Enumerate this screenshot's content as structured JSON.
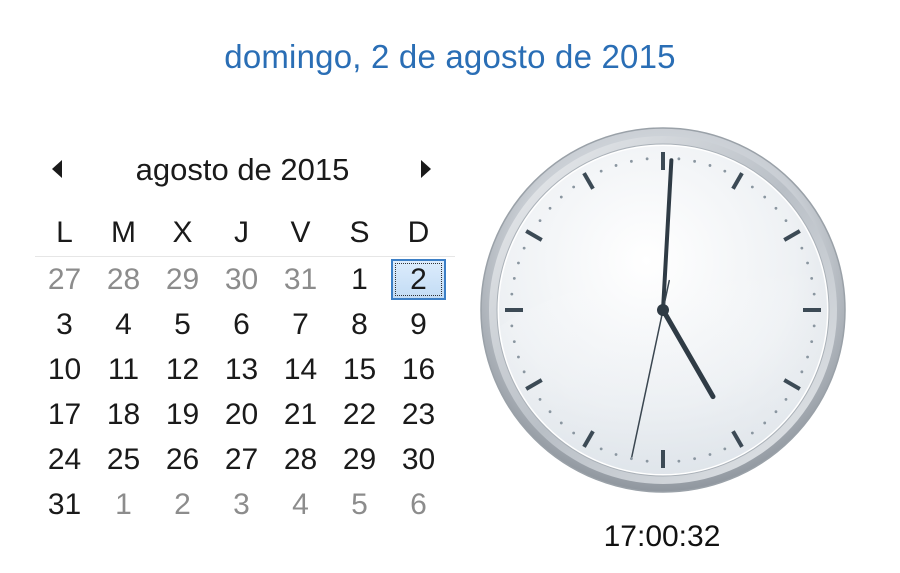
{
  "header": {
    "date_long": "domingo, 2 de agosto de 2015"
  },
  "calendar": {
    "month_title": "agosto de 2015",
    "prev_icon": "triangle-left-icon",
    "next_icon": "triangle-right-icon",
    "weekdays": [
      "L",
      "M",
      "X",
      "J",
      "V",
      "S",
      "D"
    ],
    "weeks": [
      [
        {
          "d": "27",
          "other": true
        },
        {
          "d": "28",
          "other": true
        },
        {
          "d": "29",
          "other": true
        },
        {
          "d": "30",
          "other": true
        },
        {
          "d": "31",
          "other": true
        },
        {
          "d": "1"
        },
        {
          "d": "2",
          "today": true
        }
      ],
      [
        {
          "d": "3"
        },
        {
          "d": "4"
        },
        {
          "d": "5"
        },
        {
          "d": "6"
        },
        {
          "d": "7"
        },
        {
          "d": "8"
        },
        {
          "d": "9"
        }
      ],
      [
        {
          "d": "10"
        },
        {
          "d": "11"
        },
        {
          "d": "12"
        },
        {
          "d": "13"
        },
        {
          "d": "14"
        },
        {
          "d": "15"
        },
        {
          "d": "16"
        }
      ],
      [
        {
          "d": "17"
        },
        {
          "d": "18"
        },
        {
          "d": "19"
        },
        {
          "d": "20"
        },
        {
          "d": "21"
        },
        {
          "d": "22"
        },
        {
          "d": "23"
        }
      ],
      [
        {
          "d": "24"
        },
        {
          "d": "25"
        },
        {
          "d": "26"
        },
        {
          "d": "27"
        },
        {
          "d": "28"
        },
        {
          "d": "29"
        },
        {
          "d": "30"
        }
      ],
      [
        {
          "d": "31"
        },
        {
          "d": "1",
          "other": true
        },
        {
          "d": "2",
          "other": true
        },
        {
          "d": "3",
          "other": true
        },
        {
          "d": "4",
          "other": true
        },
        {
          "d": "5",
          "other": true
        },
        {
          "d": "6",
          "other": true
        }
      ]
    ]
  },
  "clock": {
    "time_text": "17:00:32",
    "hours": 17,
    "minutes": 0,
    "seconds": 32
  },
  "colors": {
    "link": "#2a6eb5",
    "today_border": "#3c7fc6",
    "other_month_text": "#8c8c8c"
  }
}
